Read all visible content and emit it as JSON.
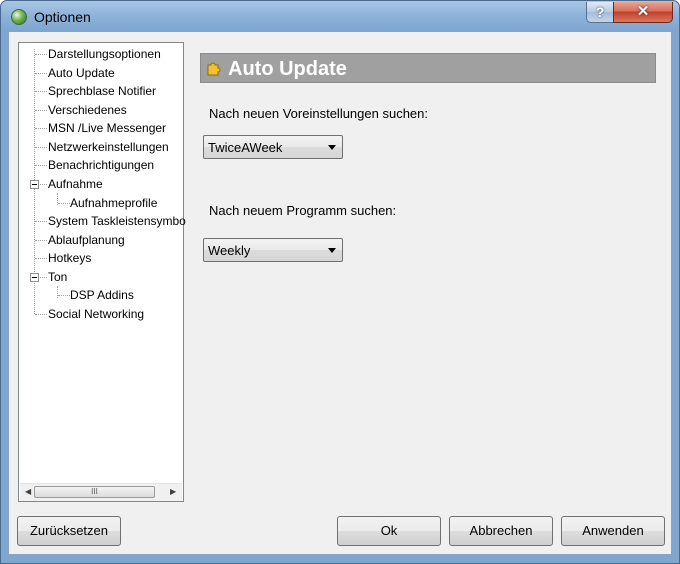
{
  "window": {
    "title": "Optionen"
  },
  "titlebar": {
    "help_label": "?",
    "close_label": "✕"
  },
  "tree": {
    "items": [
      {
        "label": "Darstellungsoptionen"
      },
      {
        "label": "Auto Update"
      },
      {
        "label": "Sprechblase Notifier"
      },
      {
        "label": "Verschiedenes"
      },
      {
        "label": "MSN /Live Messenger"
      },
      {
        "label": "Netzwerkeinstellungen"
      },
      {
        "label": "Benachrichtigungen"
      },
      {
        "label": "Aufnahme"
      },
      {
        "label": "Aufnahmeprofile"
      },
      {
        "label": "System Taskleistensymbo"
      },
      {
        "label": "Ablaufplanung"
      },
      {
        "label": "Hotkeys"
      },
      {
        "label": "Ton"
      },
      {
        "label": "DSP Addins"
      },
      {
        "label": "Social Networking"
      }
    ],
    "scroll_thumb": "III"
  },
  "panel": {
    "title": "Auto Update",
    "preset_label": "Nach neuen Voreinstellungen suchen:",
    "preset_value": "TwiceAWeek",
    "program_label": "Nach neuem Programm suchen:",
    "program_value": "Weekly"
  },
  "buttons": {
    "reset": "Zurücksetzen",
    "ok": "Ok",
    "cancel": "Abbrechen",
    "apply": "Anwenden"
  },
  "colors": {
    "header_bg": "#a0a0a0",
    "titlebar": "#8fb3da",
    "close": "#c4402a"
  }
}
